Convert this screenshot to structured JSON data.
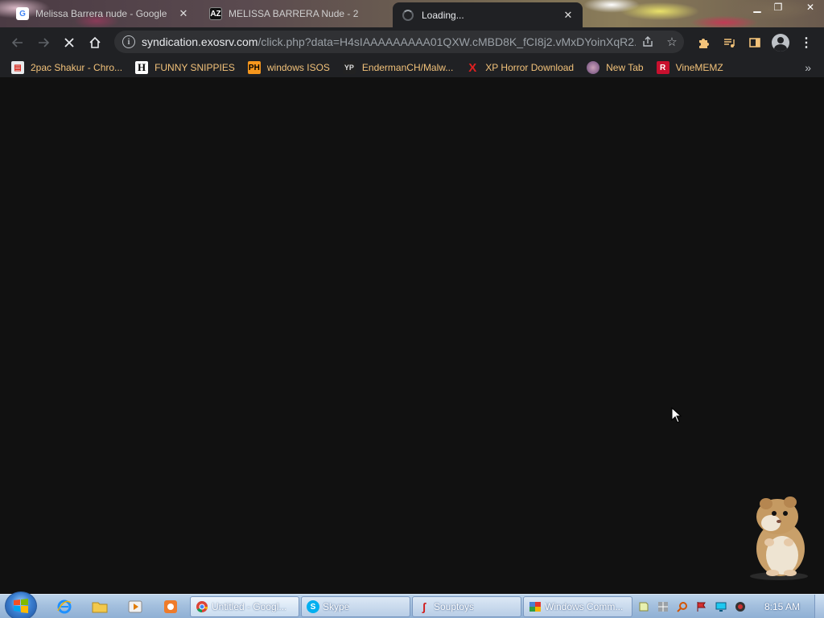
{
  "tabs": [
    {
      "title": "Melissa Barrera nude - Google",
      "icon": "google-icon",
      "active": false
    },
    {
      "title": "MELISSA BARRERA Nude - 2",
      "icon": "az-icon",
      "active": false
    },
    {
      "title": "Loading...",
      "icon": "loading-spinner-icon",
      "active": true
    }
  ],
  "tab_close_glyph": "✕",
  "url": {
    "host": "syndication.exosrv.com",
    "path": "/click.php?data=H4sIAAAAAAAAA01QXW.cMBD8K_fCI8j2.vMxDYoinXqR2..."
  },
  "bookmarks": [
    {
      "label": "2pac Shakur - Chro...",
      "icon": "chrome-store-icon"
    },
    {
      "label": "FUNNY SNIPPIES",
      "icon": "h-icon"
    },
    {
      "label": "windows ISOS",
      "icon": "ph-icon"
    },
    {
      "label": "EndermanCH/Malw...",
      "icon": "yp-icon"
    },
    {
      "label": "XP Horror Download",
      "icon": "x-icon"
    },
    {
      "label": "New Tab",
      "icon": "globe-icon"
    },
    {
      "label": "VineMEMZ",
      "icon": "r-icon"
    }
  ],
  "taskbar": {
    "tasks": [
      {
        "label": "Untitled - Googl...",
        "icon": "chrome-icon"
      },
      {
        "label": "Skype",
        "icon": "skype-icon"
      },
      {
        "label": "Souptoys",
        "icon": "souptoys-icon"
      },
      {
        "label": "Windows Comm...",
        "icon": "windows-comm-icon"
      }
    ],
    "clock": "8:15 AM"
  }
}
